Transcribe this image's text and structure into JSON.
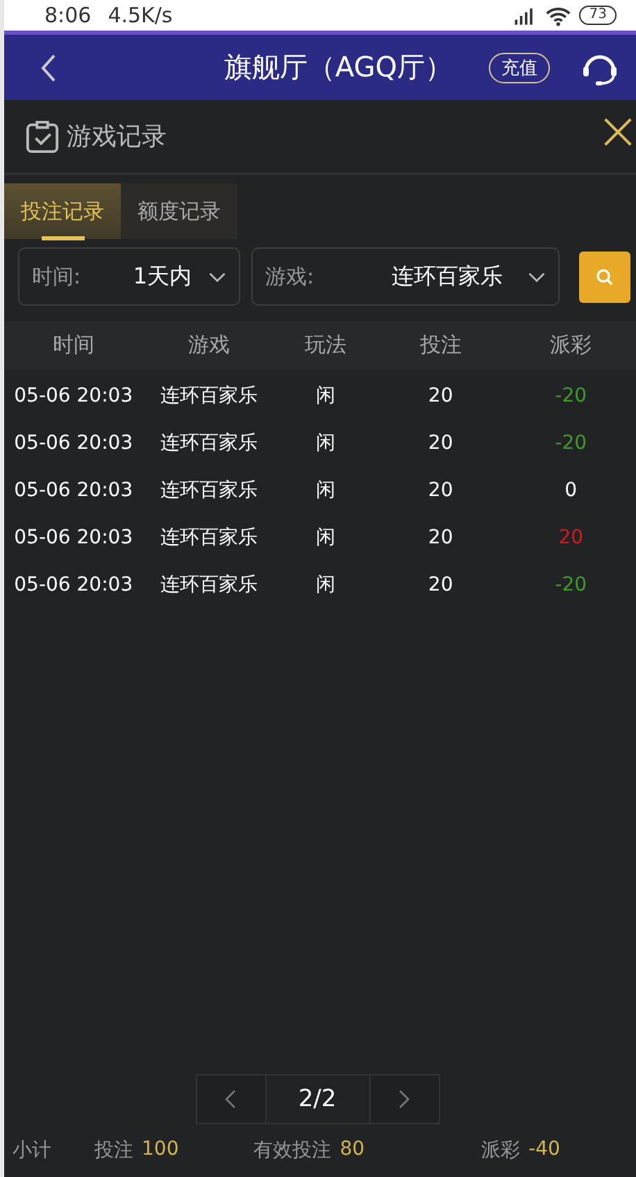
{
  "status_bar": {
    "time": "8:06",
    "speed": "4.5K/s",
    "battery": "73"
  },
  "header": {
    "title": "旗舰厅（AGQ厅）",
    "recharge": "充值"
  },
  "panel": {
    "title": "游戏记录"
  },
  "tabs": [
    {
      "label": "投注记录",
      "selected": true
    },
    {
      "label": "额度记录",
      "selected": false
    }
  ],
  "filters": [
    {
      "label": "时间:",
      "value": "1天内"
    },
    {
      "label": "游戏:",
      "value": "连环百家乐"
    }
  ],
  "table": {
    "columns": [
      "时间",
      "游戏",
      "玩法",
      "投注",
      "派彩"
    ],
    "rows": [
      {
        "time": "05-06 20:03",
        "game": "连环百家乐",
        "play": "闲",
        "bet": "20",
        "payout": "-20",
        "color": "#3f9a2c"
      },
      {
        "time": "05-06 20:03",
        "game": "连环百家乐",
        "play": "闲",
        "bet": "20",
        "payout": "-20",
        "color": "#3f9a2c"
      },
      {
        "time": "05-06 20:03",
        "game": "连环百家乐",
        "play": "闲",
        "bet": "20",
        "payout": "0",
        "color": "#ffffff"
      },
      {
        "time": "05-06 20:03",
        "game": "连环百家乐",
        "play": "闲",
        "bet": "20",
        "payout": "20",
        "color": "#d21a1a"
      },
      {
        "time": "05-06 20:03",
        "game": "连环百家乐",
        "play": "闲",
        "bet": "20",
        "payout": "-20",
        "color": "#3f9a2c"
      }
    ]
  },
  "pager": {
    "page": "2/2"
  },
  "summary": {
    "label": "小计",
    "items": [
      {
        "label": "投注",
        "value": "100"
      },
      {
        "label": "有效投注",
        "value": "80"
      },
      {
        "label": "派彩",
        "value": "-40"
      }
    ]
  }
}
